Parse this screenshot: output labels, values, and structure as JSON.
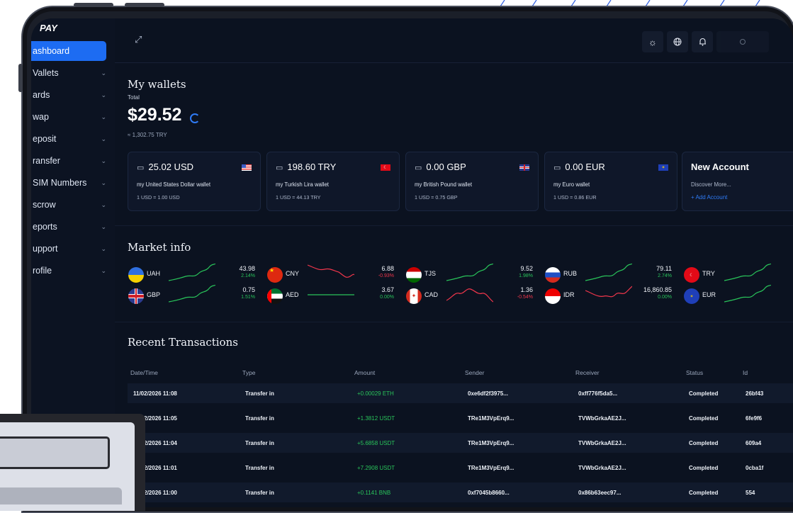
{
  "app": {
    "logo": "PAY"
  },
  "sidebar": {
    "items": [
      {
        "label": "ashboard",
        "active": true,
        "chevron": false
      },
      {
        "label": "Vallets",
        "active": false,
        "chevron": true
      },
      {
        "label": "ards",
        "active": false,
        "chevron": true
      },
      {
        "label": "wap",
        "active": false,
        "chevron": true
      },
      {
        "label": "eposit",
        "active": false,
        "chevron": true
      },
      {
        "label": "ransfer",
        "active": false,
        "chevron": true
      },
      {
        "label": "SIM Numbers",
        "active": false,
        "chevron": true
      },
      {
        "label": "scrow",
        "active": false,
        "chevron": true
      },
      {
        "label": "eports",
        "active": false,
        "chevron": true
      },
      {
        "label": "upport",
        "active": false,
        "chevron": true
      },
      {
        "label": "rofile",
        "active": false,
        "chevron": true
      }
    ]
  },
  "topbar": {
    "icons": [
      "sun-icon",
      "globe-icon",
      "bell-icon",
      "avatar-icon"
    ]
  },
  "wallets": {
    "title": "My wallets",
    "total_label": "Total",
    "balance": "$29.52",
    "balance_try": "≈ 1,302.75 TRY",
    "cards": [
      {
        "amount": "25.02 USD",
        "name": "my United States Dollar wallet",
        "rate": "1 USD = 1.00 USD",
        "flag": "us"
      },
      {
        "amount": "198.60 TRY",
        "name": "my Turkish Lira wallet",
        "rate": "1 USD = 44.13 TRY",
        "flag": "tr"
      },
      {
        "amount": "0.00 GBP",
        "name": "my British Pound wallet",
        "rate": "1 USD = 0.75 GBP",
        "flag": "gb"
      },
      {
        "amount": "0.00 EUR",
        "name": "my Euro wallet",
        "rate": "1 USD = 0.86 EUR",
        "flag": "eu"
      }
    ],
    "new_account": {
      "title": "New Account",
      "subtitle": "Discover More...",
      "add": "+ Add Account"
    }
  },
  "market": {
    "title": "Market info",
    "items": [
      {
        "code": "UAH",
        "price": "43.98",
        "change": "2.14%",
        "dir": "up",
        "flag": "ua"
      },
      {
        "code": "CNY",
        "price": "6.88",
        "change": "-0.93%",
        "dir": "down",
        "flag": "cn"
      },
      {
        "code": "TJS",
        "price": "9.52",
        "change": "1.98%",
        "dir": "up",
        "flag": "tj"
      },
      {
        "code": "RUB",
        "price": "79.11",
        "change": "2.74%",
        "dir": "up",
        "flag": "ru"
      },
      {
        "code": "TRY",
        "price": "",
        "change": "",
        "dir": "up",
        "flag": "tr"
      },
      {
        "code": "GBP",
        "price": "0.75",
        "change": "1.51%",
        "dir": "up",
        "flag": "gb"
      },
      {
        "code": "AED",
        "price": "3.67",
        "change": "0.00%",
        "dir": "flat",
        "flag": "ae"
      },
      {
        "code": "CAD",
        "price": "1.36",
        "change": "-0.54%",
        "dir": "down",
        "flag": "ca"
      },
      {
        "code": "IDR",
        "price": "16,860.85",
        "change": "0.00%",
        "dir": "down",
        "flag": "id"
      },
      {
        "code": "EUR",
        "price": "",
        "change": "",
        "dir": "up",
        "flag": "eu"
      }
    ]
  },
  "transactions": {
    "title": "Recent Transactions",
    "columns": [
      "Date/Time",
      "Type",
      "Amount",
      "Sender",
      "Receiver",
      "Status",
      "Id"
    ],
    "rows": [
      {
        "date": "11/02/2026 11:08",
        "type": "Transfer in",
        "amount": "+0.00029 ETH",
        "sender": "0xe6df2f3975...",
        "receiver": "0xff776f5da5...",
        "status": "Completed",
        "id": "26bf43"
      },
      {
        "date": "11/02/2026 11:05",
        "type": "Transfer in",
        "amount": "+1.3812 USDT",
        "sender": "TRe1M3VpErq9...",
        "receiver": "TVWbGrkaAE2J...",
        "status": "Completed",
        "id": "6fe9f6"
      },
      {
        "date": "11/02/2026 11:04",
        "type": "Transfer in",
        "amount": "+5.6858 USDT",
        "sender": "TRe1M3VpErq9...",
        "receiver": "TVWbGrkaAE2J...",
        "status": "Completed",
        "id": "609a4"
      },
      {
        "date": "11/02/2026 11:01",
        "type": "Transfer in",
        "amount": "+7.2908 USDT",
        "sender": "TRe1M3VpErq9...",
        "receiver": "TVWbGrkaAE2J...",
        "status": "Completed",
        "id": "0cba1f"
      },
      {
        "date": "11/02/2026 11:00",
        "type": "Transfer in",
        "amount": "+0.1141 BNB",
        "sender": "0xf7045b8660...",
        "receiver": "0x86b63eec97...",
        "status": "Completed",
        "id": "554"
      }
    ]
  }
}
